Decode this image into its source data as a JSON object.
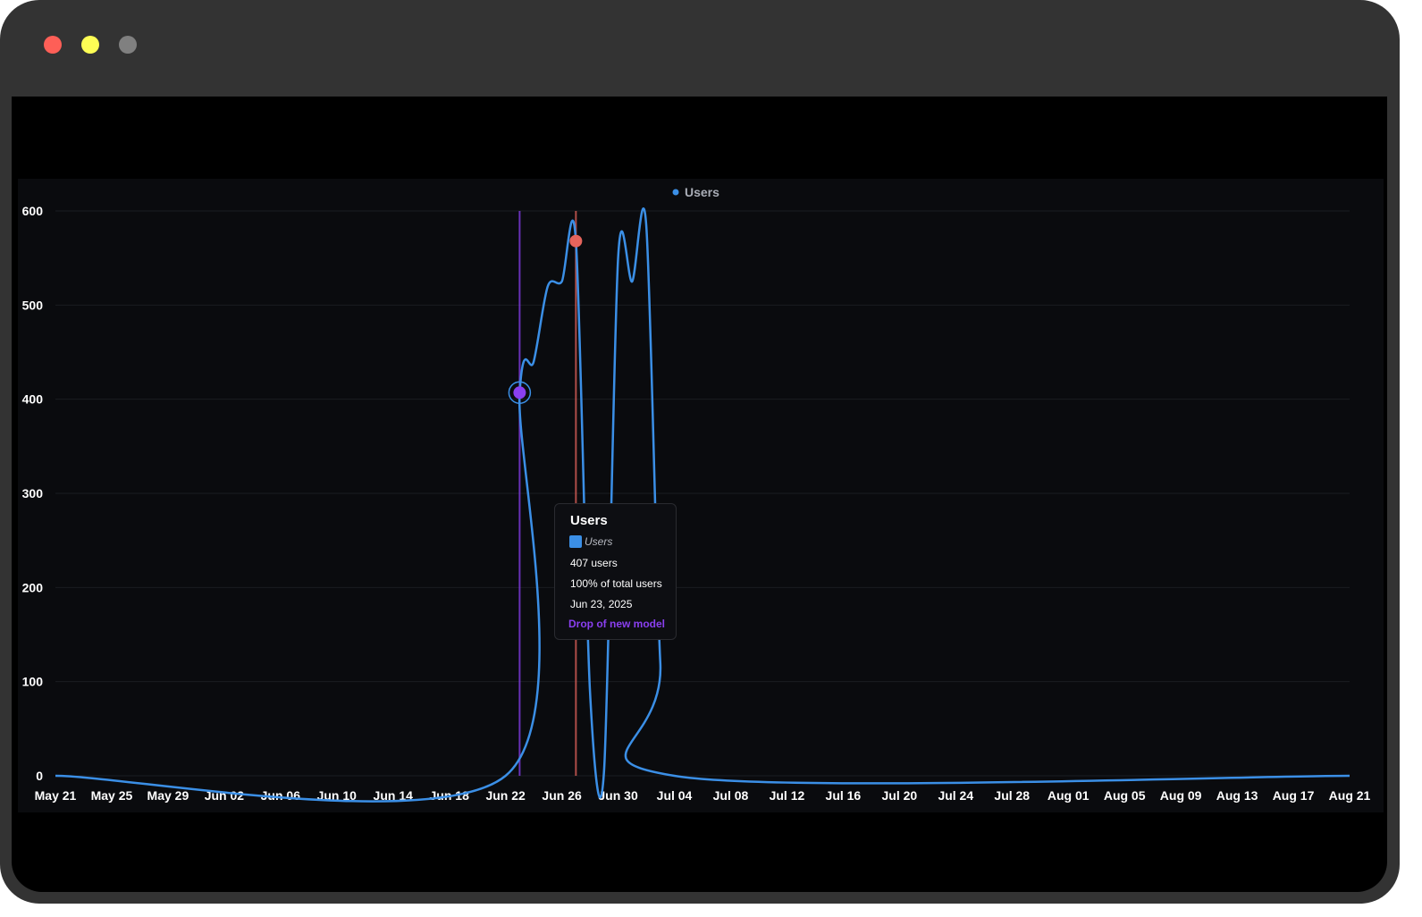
{
  "window": {
    "controls": [
      {
        "name": "close",
        "color": "#fe5f57"
      },
      {
        "name": "minimize",
        "color": "#fefe55"
      },
      {
        "name": "maximize",
        "color": "#808080"
      }
    ]
  },
  "colors": {
    "series": "#3b8fe6",
    "annotation_purple": "#8a3ff0",
    "annotation_red": "#e5645c",
    "grid": "#1b1c21",
    "tick": "#ffffff"
  },
  "chart_data": {
    "type": "line",
    "title": "",
    "xlabel": "",
    "ylabel": "",
    "ylim": [
      0,
      600
    ],
    "yticks": [
      0,
      100,
      200,
      300,
      400,
      500,
      600
    ],
    "xlim": [
      "2025-05-21",
      "2025-08-21"
    ],
    "xtick_labels": [
      "May 21",
      "May 25",
      "May 29",
      "Jun 02",
      "Jun 06",
      "Jun 10",
      "Jun 14",
      "Jun 18",
      "Jun 22",
      "Jun 26",
      "Jun 30",
      "Jul 04",
      "Jul 08",
      "Jul 12",
      "Jul 16",
      "Jul 20",
      "Jul 24",
      "Jul 28",
      "Aug 01",
      "Aug 05",
      "Aug 09",
      "Aug 13",
      "Aug 17",
      "Aug 21"
    ],
    "grid": true,
    "legend": {
      "position": "top-center",
      "entries": [
        "Users"
      ]
    },
    "series": [
      {
        "name": "Users",
        "x": [
          "2025-05-21",
          "2025-06-22",
          "2025-06-23",
          "2025-06-24",
          "2025-06-25",
          "2025-06-26",
          "2025-06-27",
          "2025-06-28",
          "2025-06-29",
          "2025-06-30",
          "2025-07-01",
          "2025-07-02",
          "2025-07-03",
          "2025-07-04",
          "2025-08-21"
        ],
        "y": [
          0,
          0,
          407,
          440,
          520,
          525,
          568,
          90,
          5,
          550,
          525,
          585,
          120,
          0,
          0
        ]
      }
    ],
    "annotations": [
      {
        "x": "2025-06-23",
        "label": "Drop of new model",
        "color": "#8a3ff0"
      },
      {
        "x": "2025-06-27",
        "color": "#e5645c"
      }
    ],
    "tooltip": {
      "title": "Users",
      "series_label": "Users",
      "value_text": "407 users",
      "share_text": "100% of total users",
      "date_text": "Jun 23, 2025",
      "annotation_text": "Drop of new model"
    }
  }
}
